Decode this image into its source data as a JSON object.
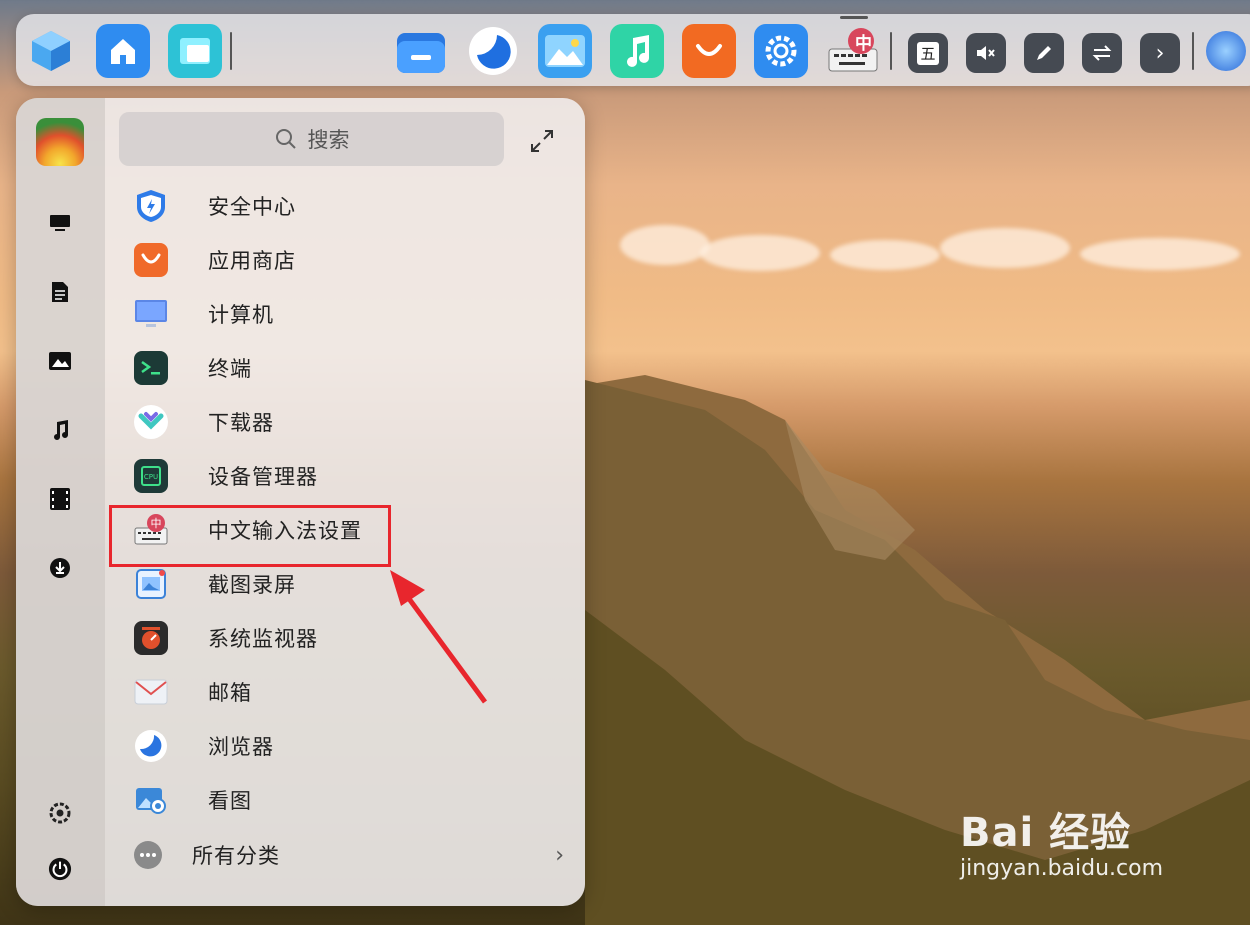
{
  "dock": {
    "tray": {
      "ime_mode": "五",
      "volume": "mute",
      "pen": "pen",
      "swap": "swap",
      "more": "›"
    },
    "ime_badge": "中"
  },
  "start_menu": {
    "search_placeholder": "搜索",
    "apps": [
      {
        "label": "安全中心",
        "icon": "shield-icon",
        "color": "#2e7be8"
      },
      {
        "label": "应用商店",
        "icon": "store-bag-icon",
        "color": "#f06a2a"
      },
      {
        "label": "计算机",
        "icon": "monitor-icon",
        "color": "#5b86e6"
      },
      {
        "label": "终端",
        "icon": "terminal-icon",
        "color": "#1c3a36"
      },
      {
        "label": "下载器",
        "icon": "download-icon",
        "color": "#3fc7c0"
      },
      {
        "label": "设备管理器",
        "icon": "cpu-icon",
        "color": "#1e3a38"
      },
      {
        "label": "中文输入法设置",
        "icon": "ime-keyboard-icon",
        "color": "#d8465c"
      },
      {
        "label": "截图录屏",
        "icon": "screenshot-icon",
        "color": "#3b82d8"
      },
      {
        "label": "系统监视器",
        "icon": "system-monitor-icon",
        "color": "#e0502c"
      },
      {
        "label": "邮箱",
        "icon": "mail-icon",
        "color": "#d8dde6"
      },
      {
        "label": "浏览器",
        "icon": "browser-icon",
        "color": "#2a74e0"
      },
      {
        "label": "看图",
        "icon": "image-viewer-icon",
        "color": "#3b88d8"
      }
    ],
    "all_categories": "所有分类",
    "sidebar": [
      "computer-icon",
      "document-icon",
      "picture-icon",
      "music-icon",
      "video-icon",
      "download-icon",
      "settings-icon",
      "power-icon"
    ]
  },
  "watermark": {
    "brand": "Bai  经验",
    "url": "jingyan.baidu.com"
  }
}
